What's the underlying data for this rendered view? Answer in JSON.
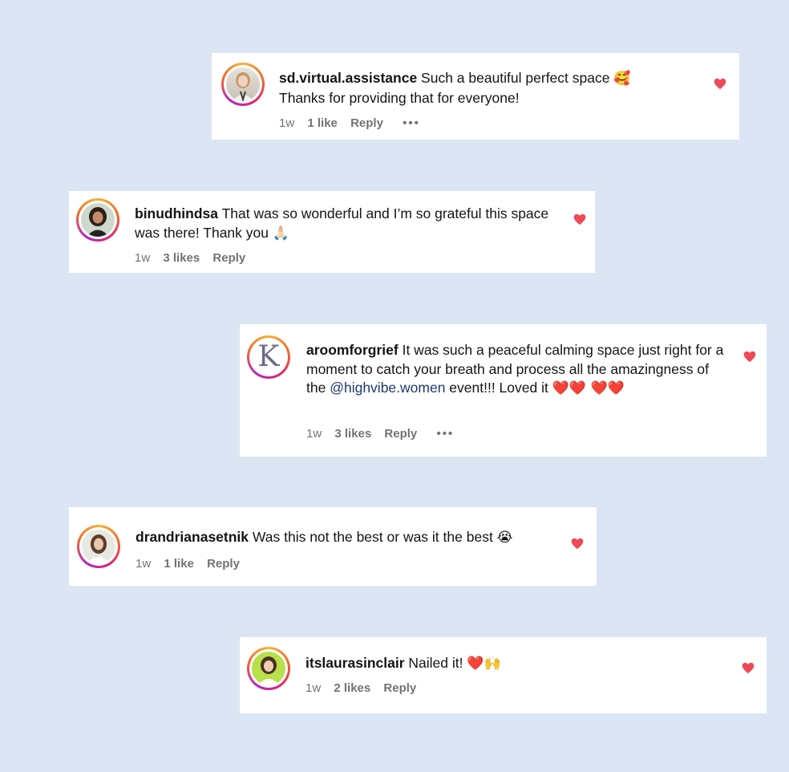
{
  "comments": [
    {
      "username": "sd.virtual.assistance",
      "text_before": " Such a beautiful perfect space ",
      "emoji": "🥰",
      "text_line2": "Thanks for providing that for everyone!",
      "age": "1w",
      "likes": "1 like",
      "reply": "Reply",
      "more": "•••"
    },
    {
      "username": "binudhindsa",
      "text_before": " That was so wonderful and I’m so grateful this space was there! Thank you ",
      "emoji": "🙏🏻",
      "age": "1w",
      "likes": "3 likes",
      "reply": "Reply"
    },
    {
      "username": "aroomforgrief",
      "text_before": " It was such a peaceful calming space just right for a moment to catch your breath and process all the amazingness of the ",
      "mention": "@highvibe.women",
      "text_after": " event!!! Loved it ",
      "emoji": "❤️❤️ ❤️❤️",
      "age": "1w",
      "likes": "3 likes",
      "reply": "Reply",
      "more": "•••",
      "avatar_letter": "K"
    },
    {
      "username": "drandrianasetnik",
      "text_before": " Was this not the best or was it the best ",
      "emoji": "😭",
      "age": "1w",
      "likes": "1 like",
      "reply": "Reply"
    },
    {
      "username": "itslaurasinclair",
      "text_before": " Nailed it! ",
      "emoji": "❤️🙌",
      "age": "1w",
      "likes": "2 likes",
      "reply": "Reply"
    }
  ],
  "colors": {
    "background": "#dbe5f3",
    "heart": "#ed4956",
    "mention": "#1e3a6e",
    "meta": "#737373"
  },
  "icons": {
    "heart": "heart-icon",
    "more": "more-options-icon"
  }
}
